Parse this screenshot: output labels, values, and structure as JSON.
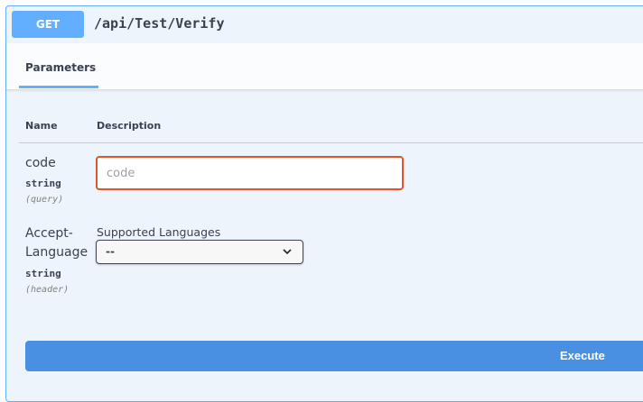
{
  "operation": {
    "method": "GET",
    "path": "/api/Test/Verify"
  },
  "tabs": [
    {
      "label": "Parameters",
      "active": true
    }
  ],
  "table": {
    "headers": {
      "name": "Name",
      "description": "Description"
    }
  },
  "parameters": [
    {
      "name": "code",
      "type": "string",
      "in": "(query)",
      "input": {
        "value": "",
        "placeholder": "code"
      }
    },
    {
      "name_line1": "Accept-",
      "name_line2": "Language",
      "type": "string",
      "in": "(header)",
      "select": {
        "label": "Supported Languages",
        "selected": "--"
      }
    }
  ],
  "actions": {
    "execute_label": "Execute"
  },
  "colors": {
    "method_get": "#61affe",
    "execute": "#4990e2",
    "input_error_border": "#e5512b"
  },
  "icons": {
    "select_arrow": "chevron-down-icon"
  }
}
